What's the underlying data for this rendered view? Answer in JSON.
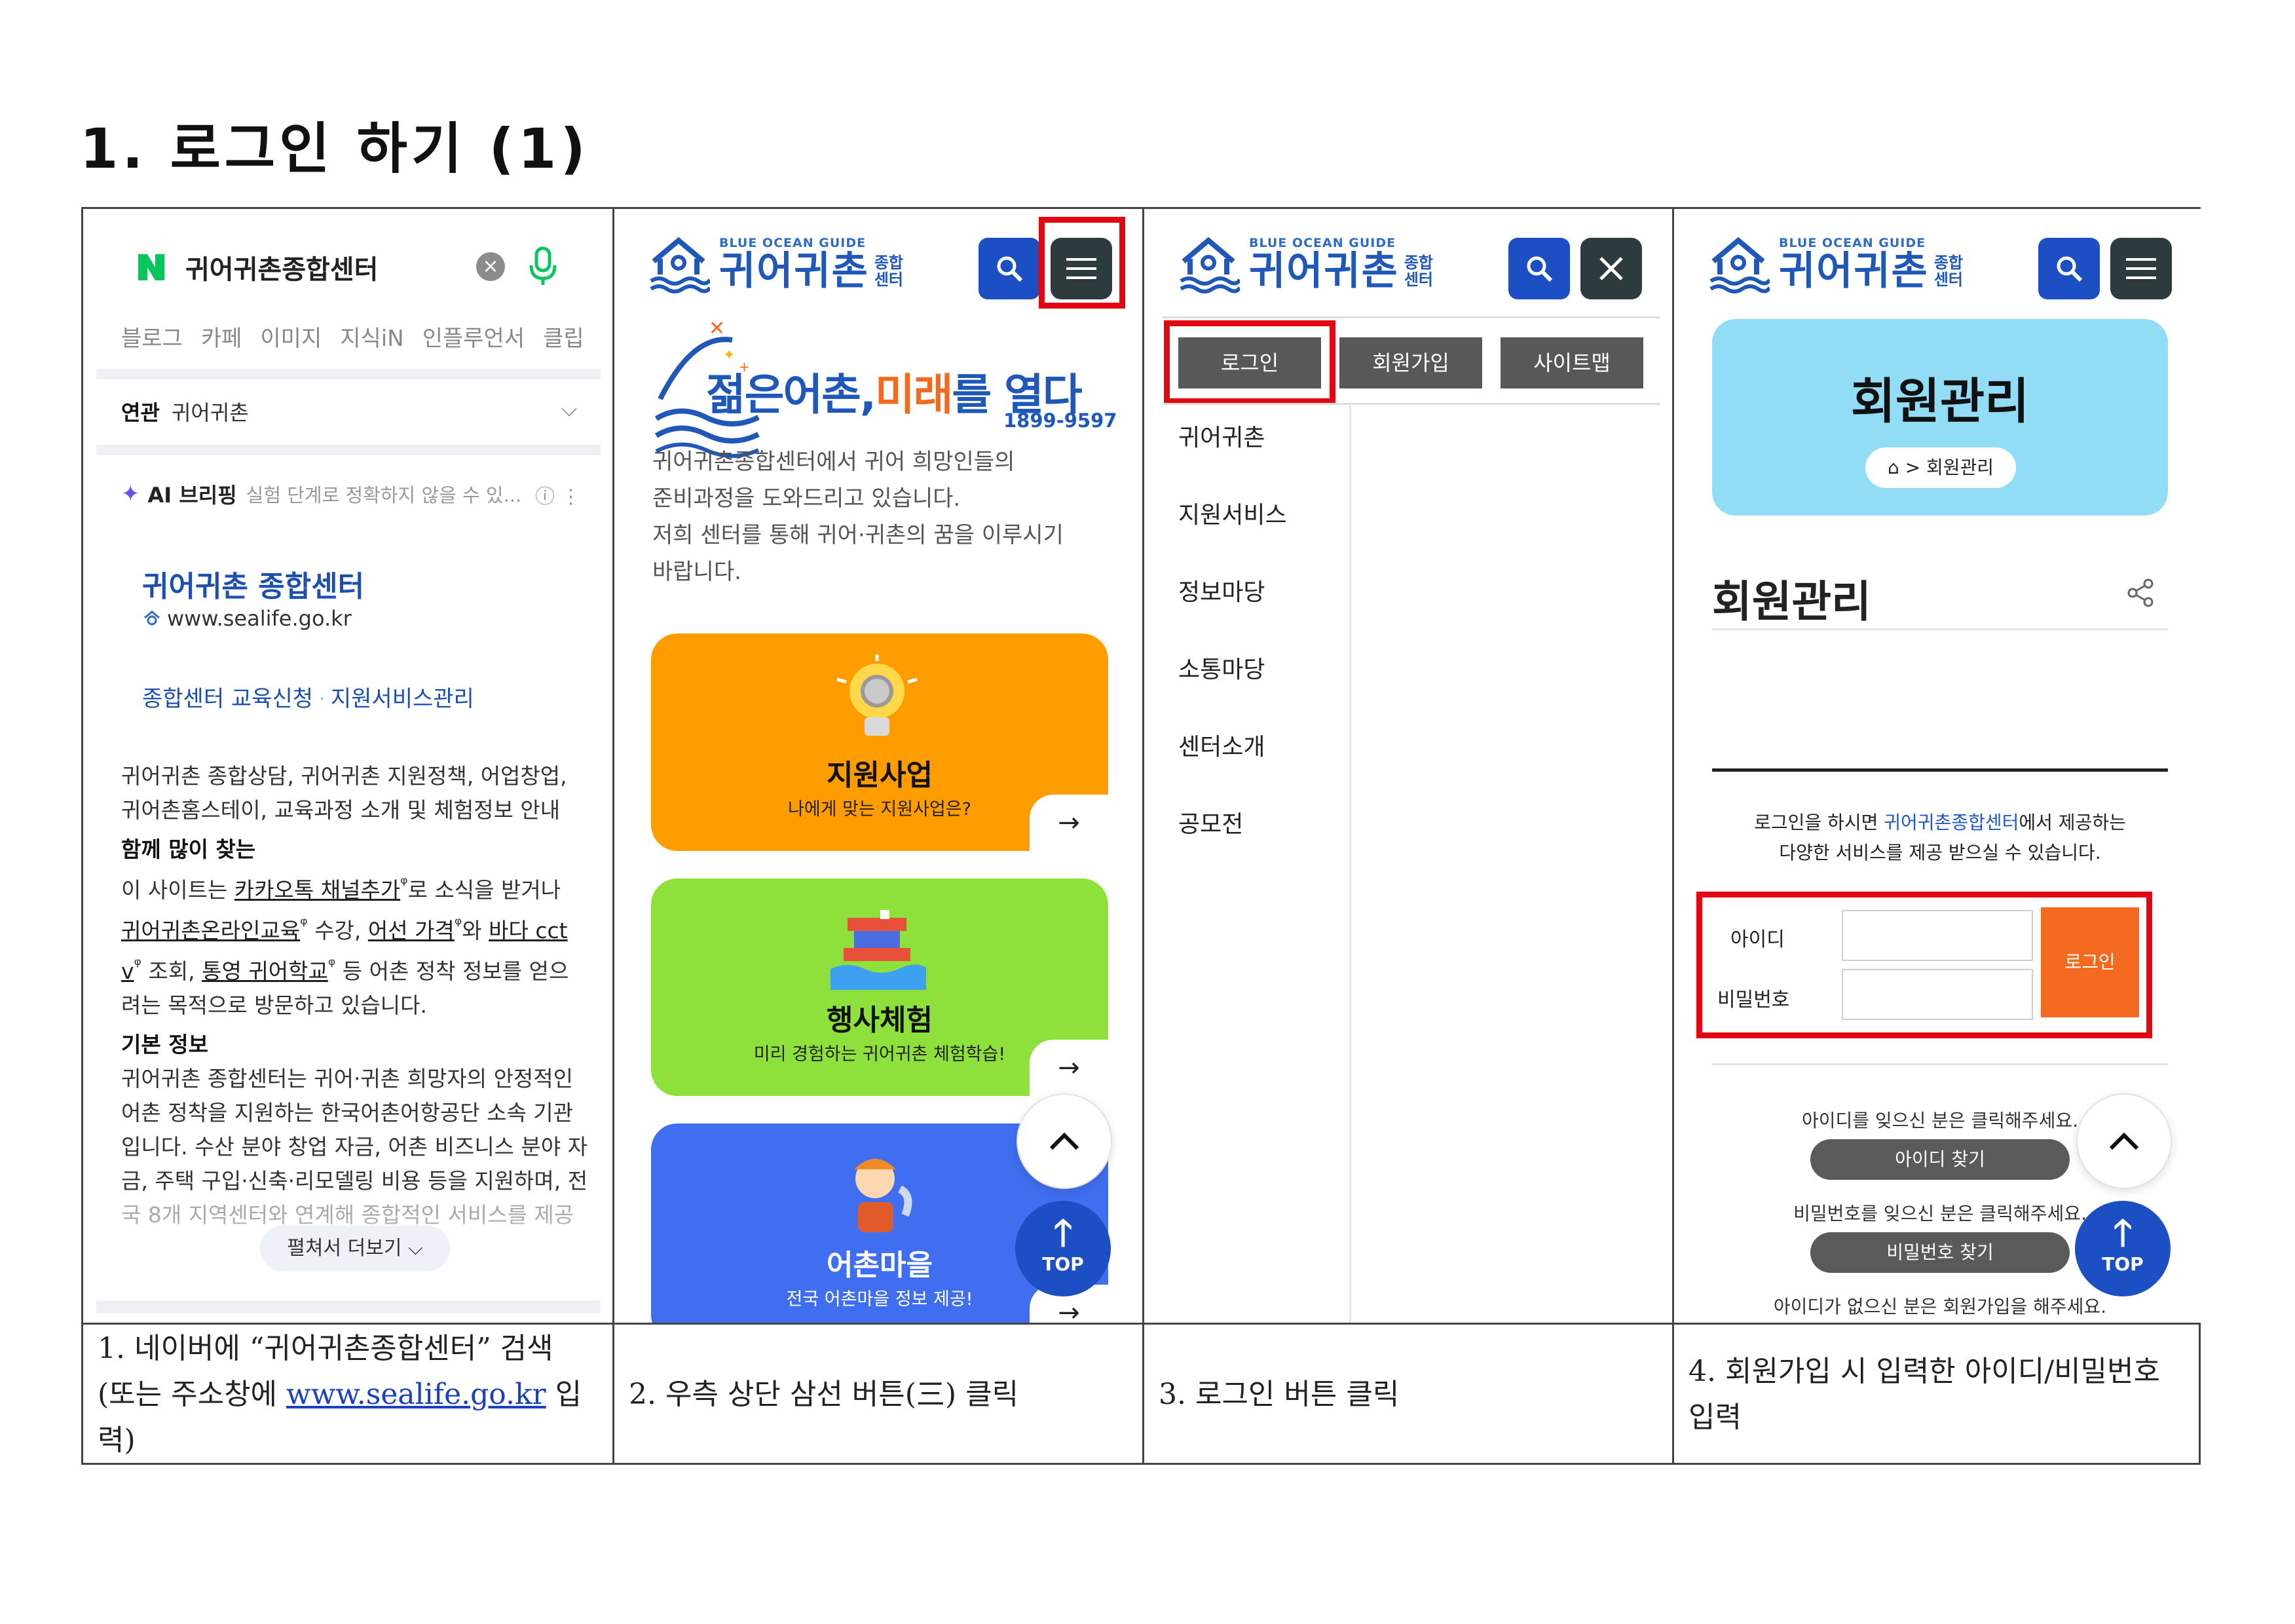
{
  "title": "1. 로그인 하기 (1)",
  "naver": {
    "query": "귀어귀촌종합센터",
    "clear_icon": "×",
    "tabs": [
      "블로그",
      "카페",
      "이미지",
      "지식iN",
      "인플루언서",
      "클립"
    ],
    "related_label": "연관",
    "related_value": "귀어귀촌",
    "ai_label": "AI 브리핑",
    "ai_note": "실험 단계로 정확하지 않을 수 있...",
    "site_title": "귀어귀촌 종합센터",
    "site_url": "www.sealife.go.kr",
    "link1": "종합센터 교육신청",
    "link_sep": "·",
    "link2": "지원서비스관리",
    "desc1": "귀어귀촌 종합상담, 귀어귀촌 지원정책, 어업창업,",
    "desc2": "귀어촌홈스테이, 교육과정 소개 및 체험정보 안내",
    "together_heading": "함께 많이 찾는",
    "together_p1": "이 사이트는 ",
    "together_l1": "카카오톡 채널추가",
    "together_p2": "로 소식을 받거나",
    "together_l2": "귀어귀촌온라인교육",
    "together_p3": " 수강, ",
    "together_l3": "어선 가격",
    "together_p4": "와 ",
    "together_l4": "바다 cct",
    "together_l4b": "v",
    "together_p5": " 조회, ",
    "together_l5": "통영 귀어학교",
    "together_p6": " 등 어촌 정착 정보를 얻으",
    "together_p7": "려는 목적으로 방문하고 있습니다.",
    "basic_heading": "기본 정보",
    "basic_1": "귀어귀촌 종합센터는 귀어·귀촌 희망자의 안정적인",
    "basic_2": "어촌 정착을 지원하는 한국어촌어항공단 소속 기관",
    "basic_3": "입니다. 수산 분야 창업 자금, 어촌 비즈니스 분야 자",
    "basic_4": "금, 주택 구입·신축·리모델링 비용 등을 지원하며, 전",
    "basic_5": "국 8개 지역센터와 연계해 종합적인 서비스를 제공",
    "more": "펼쳐서 더보기"
  },
  "site": {
    "logo_small": "BLUE OCEAN GUIDE",
    "logo_big": "귀어귀촌",
    "logo_sub1": "종합",
    "logo_sub2": "센터"
  },
  "home": {
    "slogan_a": "젊은어촌,",
    "slogan_b": "미래",
    "slogan_c": "를 열다",
    "phone": "1899-9597",
    "intro": [
      "귀어귀촌종합센터에서 귀어 희망인들의",
      "준비과정을 도와드리고 있습니다.",
      "저희 센터를 통해 귀어·귀촌의 꿈을 이루시기",
      "바랍니다."
    ],
    "cards": [
      {
        "title": "지원사업",
        "sub": "나에게 맞는 지원사업은?",
        "color": "#ff9d00"
      },
      {
        "title": "행사체험",
        "sub": "미리 경험하는 귀어귀촌 체험학습!",
        "color": "#8ee13a"
      },
      {
        "title": "어촌마을",
        "sub": "전국 어촌마을 정보 제공!",
        "color": "#3f6ef0"
      }
    ],
    "arrow": "→",
    "top_label": "TOP"
  },
  "menu": {
    "buttons": [
      "로그인",
      "회원가입",
      "사이트맵"
    ],
    "items": [
      "귀어귀촌",
      "지원서비스",
      "정보마당",
      "소통마당",
      "센터소개",
      "공모전"
    ]
  },
  "member": {
    "hero_title": "회원관리",
    "crumb": "> 회원관리",
    "page_title": "회원관리",
    "desc_a": "로그인을 하시면 ",
    "desc_hl": "귀어귀촌종합센터",
    "desc_b": "에서 제공하는",
    "desc_c": "다양한 서비스를 제공 받으실 수 있습니다.",
    "id_label": "아이디",
    "pw_label": "비밀번호",
    "login_button": "로그인",
    "forgot_id": "아이디를 잊으신 분은 클릭해주세요.",
    "find_id": "아이디 찾기",
    "forgot_pw": "비밀번호를 잊으신 분은 클릭해주세요.",
    "find_pw": "비밀번호 찾기",
    "join_note": "아이디가 없으신 분은 회원가입을 해주세요."
  },
  "captions": {
    "c1_a": "1. 네이버에 “귀어귀촌종합센터” 검색",
    "c1_b": "(또는 주소창에 ",
    "c1_link": "www.sealife.go.kr",
    "c1_c": " 입력)",
    "c2": "2. 우측 상단 삼선 버튼(三) 클릭",
    "c3": "3. 로그인 버튼 클릭",
    "c4_a": "4. 회원가입 시 입력한 아이디/비밀번호",
    "c4_b": "입력"
  },
  "colors": {
    "brand_blue": "#1d4fc4",
    "highlight_red": "#e30613",
    "login_orange": "#f46a21",
    "hero_sky": "#92ddf6"
  }
}
